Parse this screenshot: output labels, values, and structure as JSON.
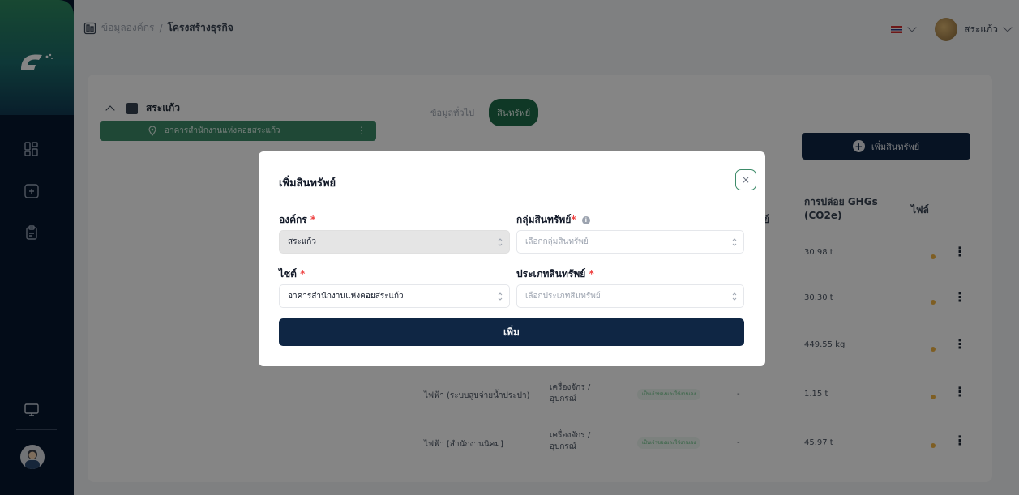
{
  "header": {
    "breadcrumb_parent": "ข้อมูลองค์กร",
    "breadcrumb_sep": "/",
    "breadcrumb_current": "โครงสร้างธุรกิจ",
    "user_name": "สระแก้ว"
  },
  "tree": {
    "org_name": "สระแก้ว",
    "site_name": "อาคารสำนักงานแห่งคอยสระแก้ว",
    "menu_glyph": "⋮"
  },
  "tabs": [
    {
      "label": "ข้อมูลทั่วไป"
    },
    {
      "label": "สินทรัพย์"
    }
  ],
  "add_asset_label": "เพิ่มสินทรัพย์",
  "table": {
    "col_partial": "ย์",
    "col_emission": "การปล่อย GHGs",
    "col_emission_unit": "(CO2e)",
    "col_file": "ไฟล์",
    "rows": [
      {
        "name": "",
        "type": "",
        "tag": "",
        "emission": "30.98 t"
      },
      {
        "name": "",
        "type": "",
        "tag": "",
        "emission": "30.30 t"
      },
      {
        "name": "",
        "type": "",
        "tag": "",
        "emission": "449.55 kg"
      },
      {
        "name": "ไฟฟ้า (ระบบสูบจ่ายน้ำประปา)",
        "type": "เครื่องจักร / อุปกรณ์",
        "tag": "เป็นเจ้าของและใช้งานเอง",
        "dash": "-",
        "emission": "1.15 t"
      },
      {
        "name": "ไฟฟ้า [สำนักงานนิคม]",
        "type": "เครื่องจักร / อุปกรณ์",
        "tag": "เป็นเจ้าของและใช้งานเอง",
        "dash": "-",
        "emission": "45.97 t"
      }
    ]
  },
  "modal": {
    "title": "เพิ่มสินทรัพย์",
    "close_glyph": "×",
    "org_label": "องค์กร",
    "org_value": "สระแก้ว",
    "group_label": "กลุ่มสินทรัพย์",
    "group_placeholder": "เลือกกลุ่มสินทรัพย์",
    "site_label": "ไซต์",
    "site_value": "อาคารสำนักงานแห่งคอยสระแก้ว",
    "type_label": "ประเภทสินทรัพย์",
    "type_placeholder": "เลือกประเภทสินทรัพย์",
    "required_mark": "*",
    "info_glyph": "i",
    "submit_label": "เพิ่ม"
  },
  "colors": {
    "sidebar_bg": "#07182e",
    "primary_navy": "#0f2644",
    "accent_green": "#1d6b4a",
    "tree_green": "#3d8b69",
    "required_red": "#ef4444"
  }
}
